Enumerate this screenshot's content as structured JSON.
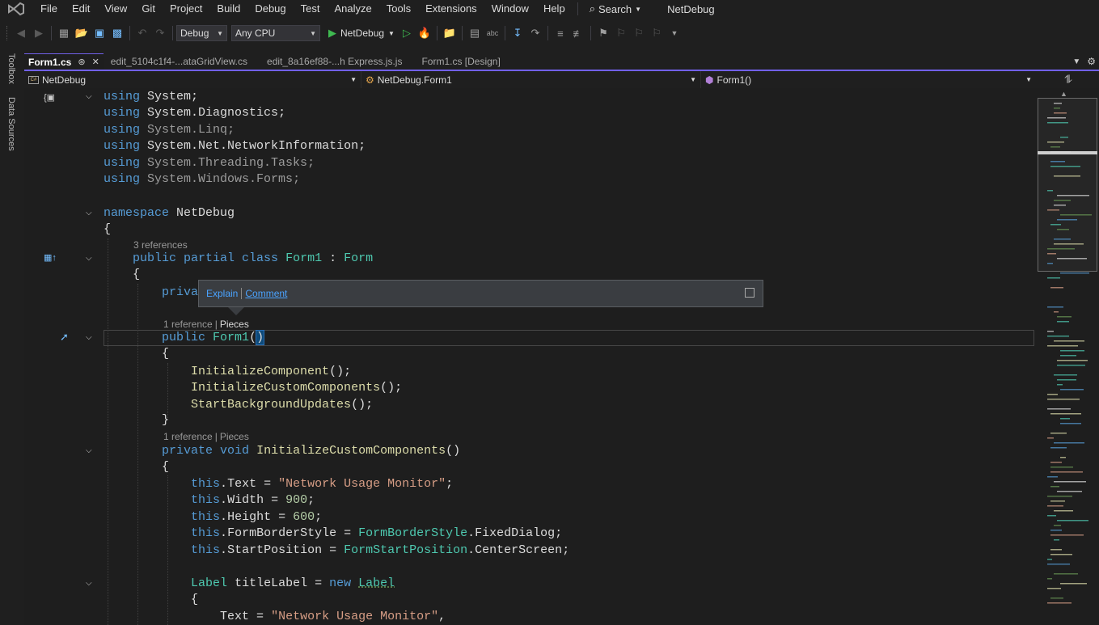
{
  "menubar": {
    "items": [
      "File",
      "Edit",
      "View",
      "Git",
      "Project",
      "Build",
      "Debug",
      "Test",
      "Analyze",
      "Tools",
      "Extensions",
      "Window",
      "Help"
    ],
    "search_label": "Search",
    "solution_name": "NetDebug"
  },
  "toolbar": {
    "configuration": "Debug",
    "platform": "Any CPU",
    "run_target": "NetDebug"
  },
  "siderail": {
    "toolbox": "Toolbox",
    "data_sources": "Data Sources"
  },
  "tabs": [
    {
      "label": "Form1.cs",
      "active": true
    },
    {
      "label": "edit_5104c1f4-...ataGridView.cs",
      "active": false
    },
    {
      "label": "edit_8a16ef88-...h Express.js.js",
      "active": false
    },
    {
      "label": "Form1.cs [Design]",
      "active": false
    }
  ],
  "navbar": {
    "project": "NetDebug",
    "type": "NetDebug.Form1",
    "member": "Form1()"
  },
  "codelens": {
    "class_refs": "3 references",
    "ctor_refs": "1 reference",
    "ctor_pieces": "Pieces",
    "method_refs": "1 reference",
    "method_pieces": "Pieces"
  },
  "popup": {
    "explain": "Explain",
    "comment": "Comment"
  },
  "code": {
    "l1_kw": "using",
    "l1_ns": "System",
    "l2_kw": "using",
    "l2_ns": "System.Diagnostics",
    "l3_kw": "using",
    "l3_ns": "System.Linq",
    "l4_kw": "using",
    "l4_ns": "System.Net.NetworkInformation",
    "l5_kw": "using",
    "l5_ns": "System.Threading.Tasks",
    "l6_kw": "using",
    "l6_ns": "System.Windows.Forms",
    "ns_kw": "namespace",
    "ns_name": "NetDebug",
    "class_mods": "public partial class",
    "class_name": "Form1",
    "class_base": "Form",
    "priv_partial": "priva",
    "ctor_kw": "public",
    "ctor_name": "Form1",
    "call1": "InitializeComponent",
    "call2": "InitializeCustomComponents",
    "call3": "StartBackgroundUpdates",
    "m_mods": "private void",
    "m_name": "InitializeCustomComponents",
    "this_kw": "this",
    "p_text": "Text",
    "v_text": "\"Network Usage Monitor\"",
    "p_width": "Width",
    "v_width": "900",
    "p_height": "Height",
    "v_height": "600",
    "p_border": "FormBorderStyle",
    "t_border": "FormBorderStyle",
    "v_border": "FixedDialog",
    "p_start": "StartPosition",
    "t_start": "FormStartPosition",
    "v_start": "CenterScreen",
    "lbl_type": "Label",
    "lbl_var": "titleLabel",
    "lbl_new": "new",
    "lbl_type2": "Label",
    "lbl_text_prop": "Text",
    "lbl_text_val": "\"Network Usage Monitor\""
  }
}
